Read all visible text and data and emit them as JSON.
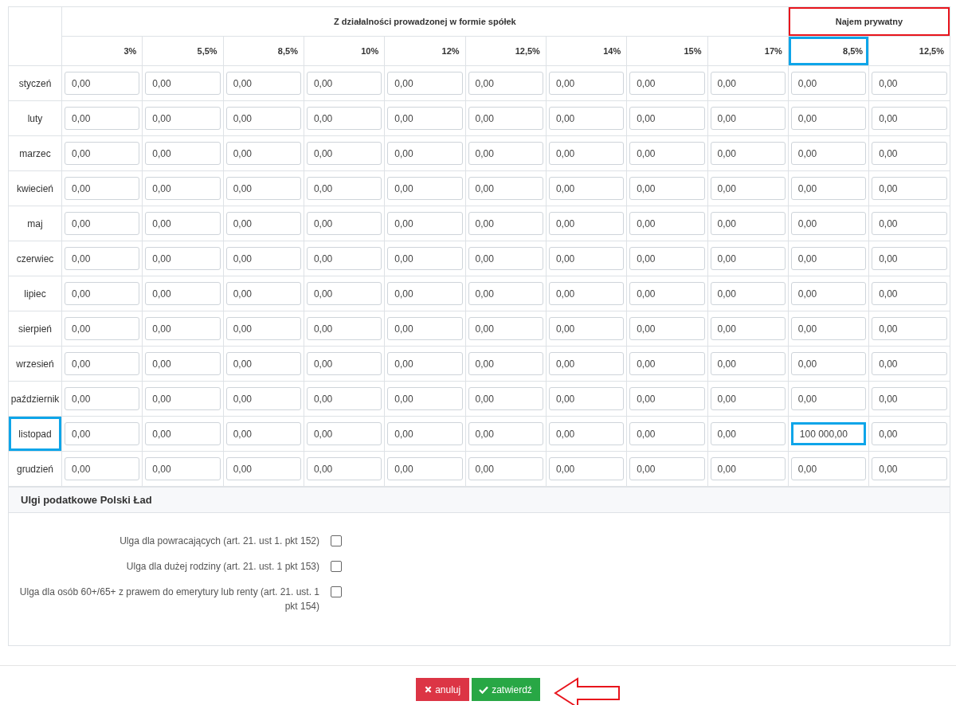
{
  "table": {
    "groups": [
      {
        "label": "Z działalności prowadzonej w formie spółek",
        "highlighted": false,
        "columns": [
          {
            "label": "3%",
            "highlighted": false
          },
          {
            "label": "5,5%",
            "highlighted": false
          },
          {
            "label": "8,5%",
            "highlighted": false
          },
          {
            "label": "10%",
            "highlighted": false
          },
          {
            "label": "12%",
            "highlighted": false
          },
          {
            "label": "12,5%",
            "highlighted": false
          },
          {
            "label": "14%",
            "highlighted": false
          },
          {
            "label": "15%",
            "highlighted": false
          },
          {
            "label": "17%",
            "highlighted": false
          }
        ]
      },
      {
        "label": "Najem prywatny",
        "highlighted": true,
        "columns": [
          {
            "label": "8,5%",
            "highlighted": true
          },
          {
            "label": "12,5%",
            "highlighted": false
          }
        ]
      }
    ],
    "rows": [
      {
        "month": "styczeń",
        "highlighted": false,
        "cells": [
          {
            "value": "0,00",
            "highlighted": false
          },
          {
            "value": "0,00",
            "highlighted": false
          },
          {
            "value": "0,00",
            "highlighted": false
          },
          {
            "value": "0,00",
            "highlighted": false
          },
          {
            "value": "0,00",
            "highlighted": false
          },
          {
            "value": "0,00",
            "highlighted": false
          },
          {
            "value": "0,00",
            "highlighted": false
          },
          {
            "value": "0,00",
            "highlighted": false
          },
          {
            "value": "0,00",
            "highlighted": false
          },
          {
            "value": "0,00",
            "highlighted": false
          },
          {
            "value": "0,00",
            "highlighted": false
          }
        ]
      },
      {
        "month": "luty",
        "highlighted": false,
        "cells": [
          {
            "value": "0,00",
            "highlighted": false
          },
          {
            "value": "0,00",
            "highlighted": false
          },
          {
            "value": "0,00",
            "highlighted": false
          },
          {
            "value": "0,00",
            "highlighted": false
          },
          {
            "value": "0,00",
            "highlighted": false
          },
          {
            "value": "0,00",
            "highlighted": false
          },
          {
            "value": "0,00",
            "highlighted": false
          },
          {
            "value": "0,00",
            "highlighted": false
          },
          {
            "value": "0,00",
            "highlighted": false
          },
          {
            "value": "0,00",
            "highlighted": false
          },
          {
            "value": "0,00",
            "highlighted": false
          }
        ]
      },
      {
        "month": "marzec",
        "highlighted": false,
        "cells": [
          {
            "value": "0,00",
            "highlighted": false
          },
          {
            "value": "0,00",
            "highlighted": false
          },
          {
            "value": "0,00",
            "highlighted": false
          },
          {
            "value": "0,00",
            "highlighted": false
          },
          {
            "value": "0,00",
            "highlighted": false
          },
          {
            "value": "0,00",
            "highlighted": false
          },
          {
            "value": "0,00",
            "highlighted": false
          },
          {
            "value": "0,00",
            "highlighted": false
          },
          {
            "value": "0,00",
            "highlighted": false
          },
          {
            "value": "0,00",
            "highlighted": false
          },
          {
            "value": "0,00",
            "highlighted": false
          }
        ]
      },
      {
        "month": "kwiecień",
        "highlighted": false,
        "cells": [
          {
            "value": "0,00",
            "highlighted": false
          },
          {
            "value": "0,00",
            "highlighted": false
          },
          {
            "value": "0,00",
            "highlighted": false
          },
          {
            "value": "0,00",
            "highlighted": false
          },
          {
            "value": "0,00",
            "highlighted": false
          },
          {
            "value": "0,00",
            "highlighted": false
          },
          {
            "value": "0,00",
            "highlighted": false
          },
          {
            "value": "0,00",
            "highlighted": false
          },
          {
            "value": "0,00",
            "highlighted": false
          },
          {
            "value": "0,00",
            "highlighted": false
          },
          {
            "value": "0,00",
            "highlighted": false
          }
        ]
      },
      {
        "month": "maj",
        "highlighted": false,
        "cells": [
          {
            "value": "0,00",
            "highlighted": false
          },
          {
            "value": "0,00",
            "highlighted": false
          },
          {
            "value": "0,00",
            "highlighted": false
          },
          {
            "value": "0,00",
            "highlighted": false
          },
          {
            "value": "0,00",
            "highlighted": false
          },
          {
            "value": "0,00",
            "highlighted": false
          },
          {
            "value": "0,00",
            "highlighted": false
          },
          {
            "value": "0,00",
            "highlighted": false
          },
          {
            "value": "0,00",
            "highlighted": false
          },
          {
            "value": "0,00",
            "highlighted": false
          },
          {
            "value": "0,00",
            "highlighted": false
          }
        ]
      },
      {
        "month": "czerwiec",
        "highlighted": false,
        "cells": [
          {
            "value": "0,00",
            "highlighted": false
          },
          {
            "value": "0,00",
            "highlighted": false
          },
          {
            "value": "0,00",
            "highlighted": false
          },
          {
            "value": "0,00",
            "highlighted": false
          },
          {
            "value": "0,00",
            "highlighted": false
          },
          {
            "value": "0,00",
            "highlighted": false
          },
          {
            "value": "0,00",
            "highlighted": false
          },
          {
            "value": "0,00",
            "highlighted": false
          },
          {
            "value": "0,00",
            "highlighted": false
          },
          {
            "value": "0,00",
            "highlighted": false
          },
          {
            "value": "0,00",
            "highlighted": false
          }
        ]
      },
      {
        "month": "lipiec",
        "highlighted": false,
        "cells": [
          {
            "value": "0,00",
            "highlighted": false
          },
          {
            "value": "0,00",
            "highlighted": false
          },
          {
            "value": "0,00",
            "highlighted": false
          },
          {
            "value": "0,00",
            "highlighted": false
          },
          {
            "value": "0,00",
            "highlighted": false
          },
          {
            "value": "0,00",
            "highlighted": false
          },
          {
            "value": "0,00",
            "highlighted": false
          },
          {
            "value": "0,00",
            "highlighted": false
          },
          {
            "value": "0,00",
            "highlighted": false
          },
          {
            "value": "0,00",
            "highlighted": false
          },
          {
            "value": "0,00",
            "highlighted": false
          }
        ]
      },
      {
        "month": "sierpień",
        "highlighted": false,
        "cells": [
          {
            "value": "0,00",
            "highlighted": false
          },
          {
            "value": "0,00",
            "highlighted": false
          },
          {
            "value": "0,00",
            "highlighted": false
          },
          {
            "value": "0,00",
            "highlighted": false
          },
          {
            "value": "0,00",
            "highlighted": false
          },
          {
            "value": "0,00",
            "highlighted": false
          },
          {
            "value": "0,00",
            "highlighted": false
          },
          {
            "value": "0,00",
            "highlighted": false
          },
          {
            "value": "0,00",
            "highlighted": false
          },
          {
            "value": "0,00",
            "highlighted": false
          },
          {
            "value": "0,00",
            "highlighted": false
          }
        ]
      },
      {
        "month": "wrzesień",
        "highlighted": false,
        "cells": [
          {
            "value": "0,00",
            "highlighted": false
          },
          {
            "value": "0,00",
            "highlighted": false
          },
          {
            "value": "0,00",
            "highlighted": false
          },
          {
            "value": "0,00",
            "highlighted": false
          },
          {
            "value": "0,00",
            "highlighted": false
          },
          {
            "value": "0,00",
            "highlighted": false
          },
          {
            "value": "0,00",
            "highlighted": false
          },
          {
            "value": "0,00",
            "highlighted": false
          },
          {
            "value": "0,00",
            "highlighted": false
          },
          {
            "value": "0,00",
            "highlighted": false
          },
          {
            "value": "0,00",
            "highlighted": false
          }
        ]
      },
      {
        "month": "październik",
        "highlighted": false,
        "cells": [
          {
            "value": "0,00",
            "highlighted": false
          },
          {
            "value": "0,00",
            "highlighted": false
          },
          {
            "value": "0,00",
            "highlighted": false
          },
          {
            "value": "0,00",
            "highlighted": false
          },
          {
            "value": "0,00",
            "highlighted": false
          },
          {
            "value": "0,00",
            "highlighted": false
          },
          {
            "value": "0,00",
            "highlighted": false
          },
          {
            "value": "0,00",
            "highlighted": false
          },
          {
            "value": "0,00",
            "highlighted": false
          },
          {
            "value": "0,00",
            "highlighted": false
          },
          {
            "value": "0,00",
            "highlighted": false
          }
        ]
      },
      {
        "month": "listopad",
        "highlighted": true,
        "cells": [
          {
            "value": "0,00",
            "highlighted": false
          },
          {
            "value": "0,00",
            "highlighted": false
          },
          {
            "value": "0,00",
            "highlighted": false
          },
          {
            "value": "0,00",
            "highlighted": false
          },
          {
            "value": "0,00",
            "highlighted": false
          },
          {
            "value": "0,00",
            "highlighted": false
          },
          {
            "value": "0,00",
            "highlighted": false
          },
          {
            "value": "0,00",
            "highlighted": false
          },
          {
            "value": "0,00",
            "highlighted": false
          },
          {
            "value": "100 000,00",
            "highlighted": true
          },
          {
            "value": "0,00",
            "highlighted": false
          }
        ]
      },
      {
        "month": "grudzień",
        "highlighted": false,
        "cells": [
          {
            "value": "0,00",
            "highlighted": false
          },
          {
            "value": "0,00",
            "highlighted": false
          },
          {
            "value": "0,00",
            "highlighted": false
          },
          {
            "value": "0,00",
            "highlighted": false
          },
          {
            "value": "0,00",
            "highlighted": false
          },
          {
            "value": "0,00",
            "highlighted": false
          },
          {
            "value": "0,00",
            "highlighted": false
          },
          {
            "value": "0,00",
            "highlighted": false
          },
          {
            "value": "0,00",
            "highlighted": false
          },
          {
            "value": "0,00",
            "highlighted": false
          },
          {
            "value": "0,00",
            "highlighted": false
          }
        ]
      }
    ]
  },
  "reliefs": {
    "title": "Ulgi podatkowe Polski Ład",
    "items": [
      {
        "label": "Ulga dla powracających (art. 21. ust 1. pkt 152)",
        "checked": false
      },
      {
        "label": "Ulga dla dużej rodziny (art. 21. ust. 1 pkt 153)",
        "checked": false
      },
      {
        "label": "Ulga dla osób 60+/65+ z prawem do emerytury lub renty (art. 21. ust. 1 pkt 154)",
        "checked": false
      }
    ]
  },
  "buttons": [
    {
      "label": "anuluj",
      "kind": "cancel"
    },
    {
      "label": "zatwierdź",
      "kind": "confirm"
    }
  ]
}
